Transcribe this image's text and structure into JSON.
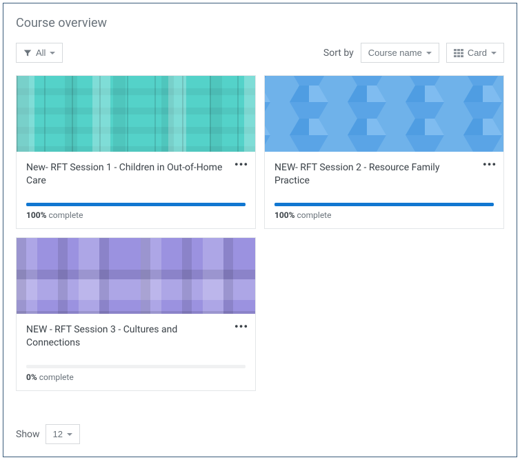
{
  "header": {
    "title": "Course overview"
  },
  "controls": {
    "filter_label": "All",
    "sort_label": "Sort by",
    "sort_value": "Course name",
    "view_label": "Card",
    "show_label": "Show",
    "show_value": "12"
  },
  "courses": [
    {
      "title": "New- RFT Session 1 - Children in Out-of-Home Care",
      "progress_pct": 100,
      "progress_pct_text": "100%",
      "progress_word": "complete",
      "pattern": "pattern-teal"
    },
    {
      "title": "NEW- RFT Session 2 - Resource Family Practice",
      "progress_pct": 100,
      "progress_pct_text": "100%",
      "progress_word": "complete",
      "pattern": "pattern-blue"
    },
    {
      "title": "NEW - RFT Session 3 - Cultures and Connections",
      "progress_pct": 0,
      "progress_pct_text": "0%",
      "progress_word": "complete",
      "pattern": "pattern-purple"
    }
  ]
}
